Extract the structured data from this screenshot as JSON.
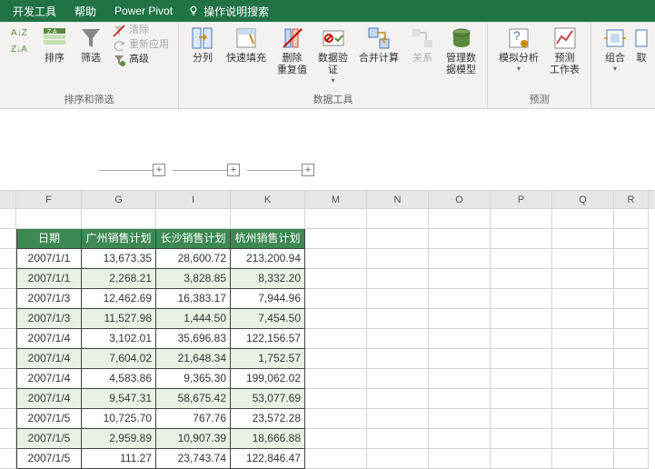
{
  "ribbon": {
    "tabs": {
      "dev": "开发工具",
      "help": "帮助",
      "pivot": "Power Pivot",
      "hint": "操作说明搜索"
    },
    "groups": {
      "sortFilter": {
        "label": "排序和筛选",
        "sort": "排序",
        "filter": "筛选",
        "clear": "清除",
        "reapply": "重新应用",
        "advanced": "高级"
      },
      "dataTools": {
        "label": "数据工具",
        "textToCol": "分列",
        "flashFill": "快速填充",
        "removeDup": "删除\n重复值",
        "validation": "数据验\n证",
        "consolidate": "合并计算",
        "relations": "关系",
        "dataModel": "管理数\n据模型"
      },
      "forecast": {
        "label": "预测",
        "whatif": "模拟分析",
        "forecastSheet": "预测\n工作表"
      },
      "outline": {
        "group": "组合",
        "more": "取"
      }
    }
  },
  "sheet": {
    "cols": [
      "F",
      "G",
      "I",
      "K",
      "M",
      "N",
      "O",
      "P",
      "Q",
      "R"
    ],
    "headers": {
      "date": "日期",
      "gz": "广州销售计划",
      "cs": "长沙销售计划",
      "hz": "杭州销售计划"
    },
    "rows": [
      {
        "d": "2007/1/1",
        "g": "13,673.35",
        "c": "28,600.72",
        "h": "213,200.94"
      },
      {
        "d": "2007/1/1",
        "g": "2,268.21",
        "c": "3,828.85",
        "h": "8,332.20"
      },
      {
        "d": "2007/1/3",
        "g": "12,462.69",
        "c": "16,383.17",
        "h": "7,944.96"
      },
      {
        "d": "2007/1/3",
        "g": "11,527.98",
        "c": "1,444.50",
        "h": "7,454.50"
      },
      {
        "d": "2007/1/4",
        "g": "3,102.01",
        "c": "35,696.83",
        "h": "122,156.57"
      },
      {
        "d": "2007/1/4",
        "g": "7,604.02",
        "c": "21,648.34",
        "h": "1,752.57"
      },
      {
        "d": "2007/1/4",
        "g": "4,583.86",
        "c": "9,365.30",
        "h": "199,062.02"
      },
      {
        "d": "2007/1/4",
        "g": "9,547.31",
        "c": "58,675.42",
        "h": "53,077.69"
      },
      {
        "d": "2007/1/5",
        "g": "10,725.70",
        "c": "767.76",
        "h": "23,572.28"
      },
      {
        "d": "2007/1/5",
        "g": "2,959.89",
        "c": "10,907.39",
        "h": "18,666.88"
      },
      {
        "d": "2007/1/5",
        "g": "111.27",
        "c": "23,743.74",
        "h": "122,846.47"
      }
    ]
  }
}
